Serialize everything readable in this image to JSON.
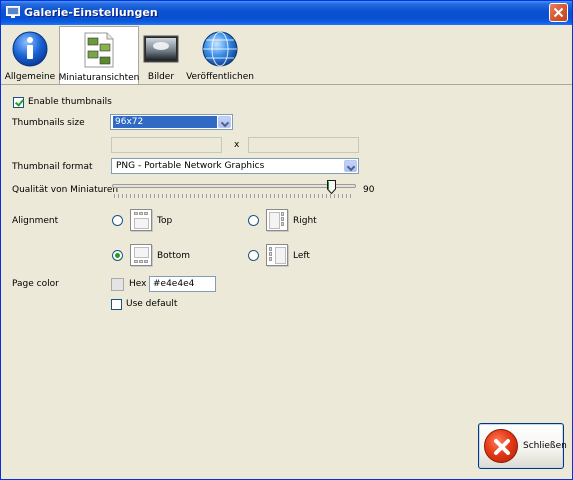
{
  "window": {
    "title": "Galerie-Einstellungen"
  },
  "toolbar": {
    "items": [
      {
        "label": "Allgemeine",
        "icon": "info-icon"
      },
      {
        "label": "Miniaturansichten",
        "icon": "thumbnails-icon",
        "active": true
      },
      {
        "label": "Bilder",
        "icon": "image-icon"
      },
      {
        "label": "Veröffentlichen",
        "icon": "globe-icon"
      }
    ]
  },
  "form": {
    "enable_thumbnails_label": "Enable thumbnails",
    "enable_thumbnails_checked": true,
    "size_label": "Thumbnails size",
    "size_value": "96x72",
    "custom_width": "",
    "custom_height": "",
    "by_separator": "x",
    "format_label": "Thumbnail format",
    "format_value": "PNG - Portable Network Graphics",
    "quality_label": "Qualität von Miniaturen",
    "quality_value": "90",
    "quality_fraction": 0.9,
    "alignment_label": "Alignment",
    "align_top": "Top",
    "align_right": "Right",
    "align_bottom": "Bottom",
    "align_left": "Left",
    "align_selected": "Bottom",
    "page_color_label": "Page color",
    "hex_label": "Hex",
    "hex_value": "#e4e4e4",
    "use_default_label": "Use default",
    "use_default_checked": false
  },
  "footer": {
    "close_label": "Schließen"
  },
  "colors": {
    "titlebar": "#0b53d4",
    "page_color": "#e4e4e4",
    "selection": "#316ac5"
  }
}
